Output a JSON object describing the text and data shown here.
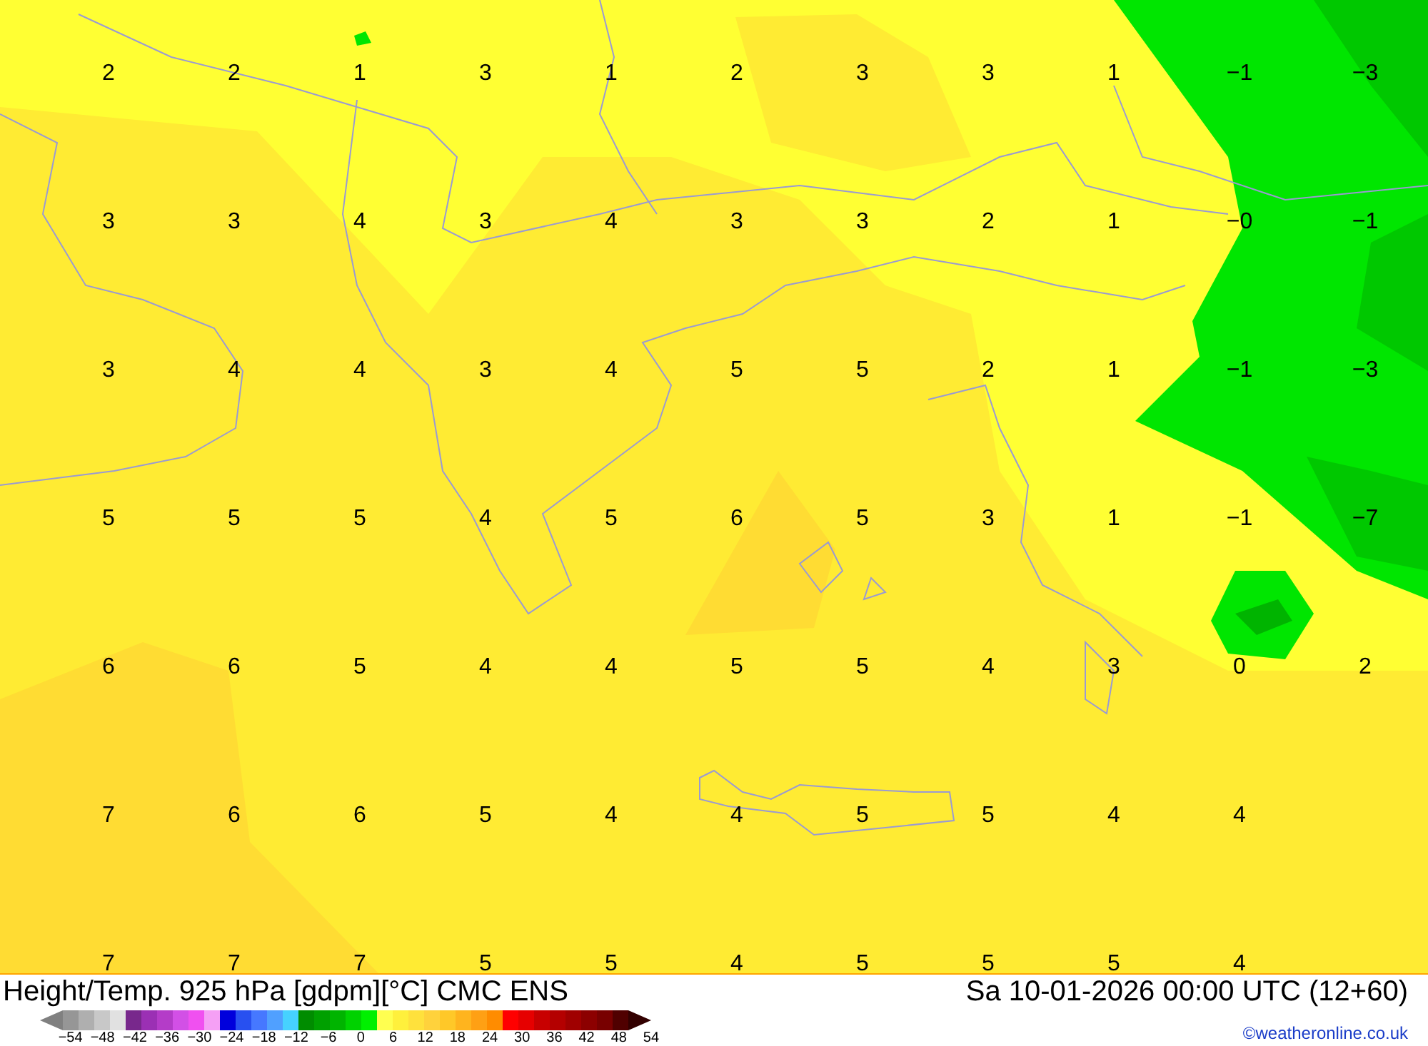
{
  "map": {
    "rows": [
      [
        "2",
        "2",
        "1",
        "3",
        "1",
        "2",
        "3",
        "3",
        "1",
        "−1",
        "−3"
      ],
      [
        "3",
        "3",
        "4",
        "3",
        "4",
        "3",
        "3",
        "2",
        "1",
        "−0",
        "−1"
      ],
      [
        "3",
        "4",
        "4",
        "3",
        "4",
        "5",
        "5",
        "2",
        "1",
        "−1",
        "−3"
      ],
      [
        "5",
        "5",
        "5",
        "4",
        "5",
        "6",
        "5",
        "3",
        "1",
        "−1",
        "−7"
      ],
      [
        "6",
        "6",
        "5",
        "4",
        "4",
        "5",
        "5",
        "4",
        "3",
        "0",
        "2"
      ],
      [
        "7",
        "6",
        "6",
        "5",
        "4",
        "4",
        "5",
        "5",
        "4",
        "4"
      ],
      [
        "7",
        "7",
        "7",
        "5",
        "5",
        "4",
        "5",
        "5",
        "5",
        "4"
      ]
    ]
  },
  "footer": {
    "title": "Height/Temp. 925 hPa [gdpm][°C] CMC ENS",
    "datetime": "Sa 10-01-2026 00:00 UTC (12+60)",
    "credit": "©weatheronline.co.uk"
  },
  "legend": {
    "colors": [
      {
        "color": "#969696"
      },
      {
        "color": "#afafaf"
      },
      {
        "color": "#c8c8c8"
      },
      {
        "color": "#e1e1e1"
      },
      {
        "color": "#78288c"
      },
      {
        "color": "#9b30b4"
      },
      {
        "color": "#b43cc8"
      },
      {
        "color": "#d250e6"
      },
      {
        "color": "#f050f0"
      },
      {
        "color": "#f5a0f5"
      },
      {
        "color": "#0000dc"
      },
      {
        "color": "#2850f0"
      },
      {
        "color": "#4678ff"
      },
      {
        "color": "#50a0ff"
      },
      {
        "color": "#46d2ff"
      },
      {
        "color": "#008c00"
      },
      {
        "color": "#00a000"
      },
      {
        "color": "#00b400"
      },
      {
        "color": "#00d200"
      },
      {
        "color": "#00f000"
      },
      {
        "color": "#ffff50"
      },
      {
        "color": "#fff03c"
      },
      {
        "color": "#ffe13c"
      },
      {
        "color": "#ffd23c"
      },
      {
        "color": "#ffc828"
      },
      {
        "color": "#ffb41e"
      },
      {
        "color": "#ffa014"
      },
      {
        "color": "#ff8c00"
      },
      {
        "color": "#ff0000"
      },
      {
        "color": "#e60000"
      },
      {
        "color": "#c80000"
      },
      {
        "color": "#b40000"
      },
      {
        "color": "#a00000"
      },
      {
        "color": "#8c0000"
      },
      {
        "color": "#780000"
      },
      {
        "color": "#500000"
      }
    ],
    "labels": [
      "−54",
      "−48",
      "−42",
      "−36",
      "−30",
      "−24",
      "−18",
      "−12",
      "−6",
      "0",
      "6",
      "12",
      "18",
      "24",
      "30",
      "36",
      "42",
      "48",
      "54"
    ]
  }
}
